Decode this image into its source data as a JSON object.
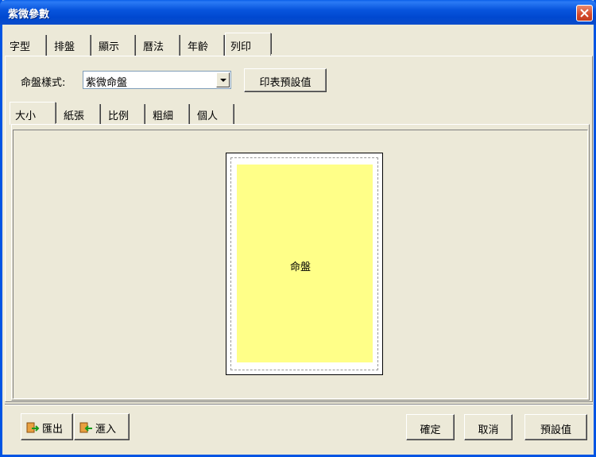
{
  "window": {
    "title": "紫微參數"
  },
  "top_tabs": [
    {
      "label": "字型"
    },
    {
      "label": "排盤"
    },
    {
      "label": "顯示"
    },
    {
      "label": "曆法"
    },
    {
      "label": "年齡"
    },
    {
      "label": "列印",
      "active": true
    }
  ],
  "print": {
    "style_label": "命盤樣式:",
    "style_value": "紫微命盤",
    "print_default_label": "印表預設值"
  },
  "inner_tabs": [
    {
      "label": "大小",
      "active": true
    },
    {
      "label": "紙張"
    },
    {
      "label": "比例"
    },
    {
      "label": "粗細"
    },
    {
      "label": "個人"
    }
  ],
  "preview": {
    "chart_label": "命盤",
    "chart_color": "#FFFF88"
  },
  "footer": {
    "export_label": "匯出",
    "import_label": "滙入",
    "ok_label": "確定",
    "cancel_label": "取消",
    "default_label": "預設值"
  },
  "colors": {
    "title_bar": "#0054E3",
    "background": "#ECE9D8",
    "close": "#D4482A"
  },
  "icons": {
    "close": "close-icon",
    "export": "export-icon",
    "import": "import-icon",
    "dropdown": "chevron-down-icon"
  }
}
